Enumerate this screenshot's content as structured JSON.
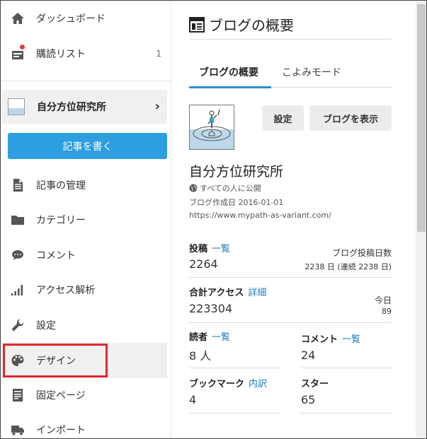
{
  "sidebar": {
    "items": [
      {
        "label": "ダッシュボード",
        "icon": "home-icon"
      },
      {
        "label": "購読リスト",
        "icon": "subscription-icon",
        "count": "1"
      },
      {
        "label": "記事の管理",
        "icon": "document-icon"
      },
      {
        "label": "カテゴリー",
        "icon": "folder-icon"
      },
      {
        "label": "コメント",
        "icon": "comment-icon"
      },
      {
        "label": "アクセス解析",
        "icon": "signal-bars-icon"
      },
      {
        "label": "設定",
        "icon": "wrench-icon"
      },
      {
        "label": "デザイン",
        "icon": "palette-icon"
      },
      {
        "label": "固定ページ",
        "icon": "page-icon"
      },
      {
        "label": "インポート",
        "icon": "truck-icon"
      }
    ],
    "blog": {
      "name": "自分方位研究所"
    },
    "write_button": "記事を書く"
  },
  "main": {
    "title": "ブログの概要",
    "tabs": [
      {
        "label": "ブログの概要",
        "active": true
      },
      {
        "label": "こよみモード",
        "active": false
      }
    ],
    "buttons": {
      "settings": "設定",
      "view_blog": "ブログを表示"
    },
    "blog_name": "自分方位研究所",
    "visibility": "すべての人に公開",
    "created": "ブログ作成日 2016-01-01",
    "url": "https://www.mypath-as-variant.com/",
    "stats": {
      "posts": {
        "label": "投稿",
        "link": "一覧",
        "value": "2264",
        "sub_label": "ブログ投稿日数",
        "sub_value": "2238 日 (連続 2238 日)"
      },
      "access": {
        "label": "合計アクセス",
        "link": "詳細",
        "value": "223304",
        "sub_label": "今日",
        "sub_value": "89"
      },
      "readers": {
        "label": "読者",
        "link": "一覧",
        "value": "8 人"
      },
      "comments": {
        "label": "コメント",
        "link": "一覧",
        "value": "24"
      },
      "bookmarks": {
        "label": "ブックマーク",
        "link": "内訳",
        "value": "4"
      },
      "stars": {
        "label": "スター",
        "value": "65"
      }
    }
  },
  "colors": {
    "accent": "#2d9ee0",
    "highlight_box": "#e0282d",
    "link": "#1f7ab8"
  }
}
